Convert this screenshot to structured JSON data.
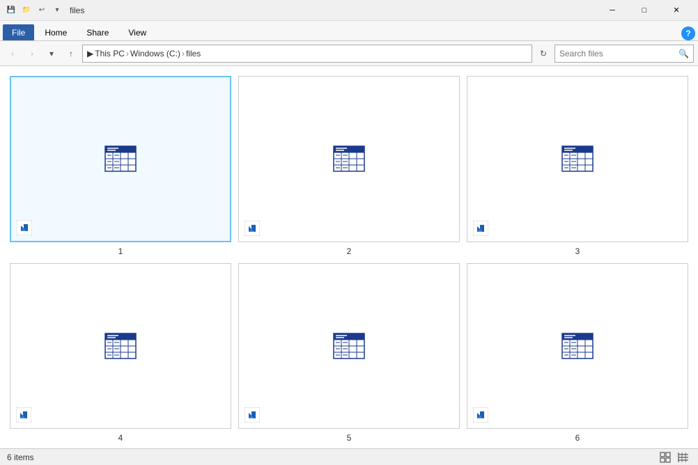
{
  "window": {
    "title": "files",
    "title_icons": [
      "📁",
      "◻",
      "💾"
    ],
    "controls": {
      "minimize": "─",
      "maximize": "□",
      "close": "✕"
    }
  },
  "ribbon": {
    "tabs": [
      {
        "label": "File",
        "active": true
      },
      {
        "label": "Home",
        "active": false
      },
      {
        "label": "Share",
        "active": false
      },
      {
        "label": "View",
        "active": false
      }
    ]
  },
  "address_bar": {
    "back": "‹",
    "forward": "›",
    "up": "↑",
    "path_parts": [
      "This PC",
      "Windows (C:)",
      "files"
    ],
    "refresh": "↻",
    "search_placeholder": "Search files"
  },
  "files": [
    {
      "id": 1,
      "name": "1",
      "selected": true
    },
    {
      "id": 2,
      "name": "2",
      "selected": false
    },
    {
      "id": 3,
      "name": "3",
      "selected": false
    },
    {
      "id": 4,
      "name": "4",
      "selected": false
    },
    {
      "id": 5,
      "name": "5",
      "selected": false
    },
    {
      "id": 6,
      "name": "6",
      "selected": false
    }
  ],
  "status": {
    "items_count": "6 items"
  }
}
